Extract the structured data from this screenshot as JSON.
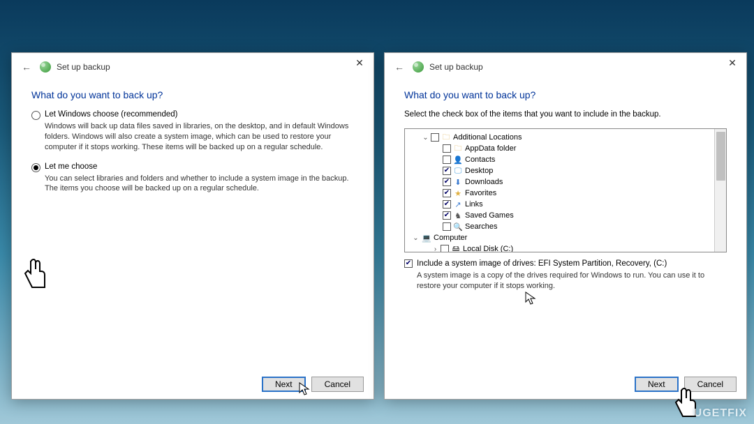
{
  "leftDialog": {
    "title": "Set up backup",
    "heading": "What do you want to back up?",
    "option1": {
      "label": "Let Windows choose (recommended)",
      "desc": "Windows will back up data files saved in libraries, on the desktop, and in default Windows folders. Windows will also create a system image, which can be used to restore your computer if it stops working. These items will be backed up on a regular schedule."
    },
    "option2": {
      "label": "Let me choose",
      "desc": "You can select libraries and folders and whether to include a system image in the backup. The items you choose will be backed up on a regular schedule."
    },
    "next": "Next",
    "cancel": "Cancel"
  },
  "rightDialog": {
    "title": "Set up backup",
    "heading": "What do you want to back up?",
    "instruction": "Select the check box of the items that you want to include in the backup.",
    "tree": {
      "additional": "Additional Locations",
      "appdata": "AppData folder",
      "contacts": "Contacts",
      "desktop": "Desktop",
      "downloads": "Downloads",
      "favorites": "Favorites",
      "links": "Links",
      "savedgames": "Saved Games",
      "searches": "Searches",
      "computer": "Computer",
      "localdisk": "Local Disk (C:)"
    },
    "includeLabel": "Include a system image of drives: EFI System Partition, Recovery, (C:)",
    "includeDesc": "A system image is a copy of the drives required for Windows to run. You can use it to restore your computer if it stops working.",
    "next": "Next",
    "cancel": "Cancel"
  },
  "watermark": "UGETFIX"
}
